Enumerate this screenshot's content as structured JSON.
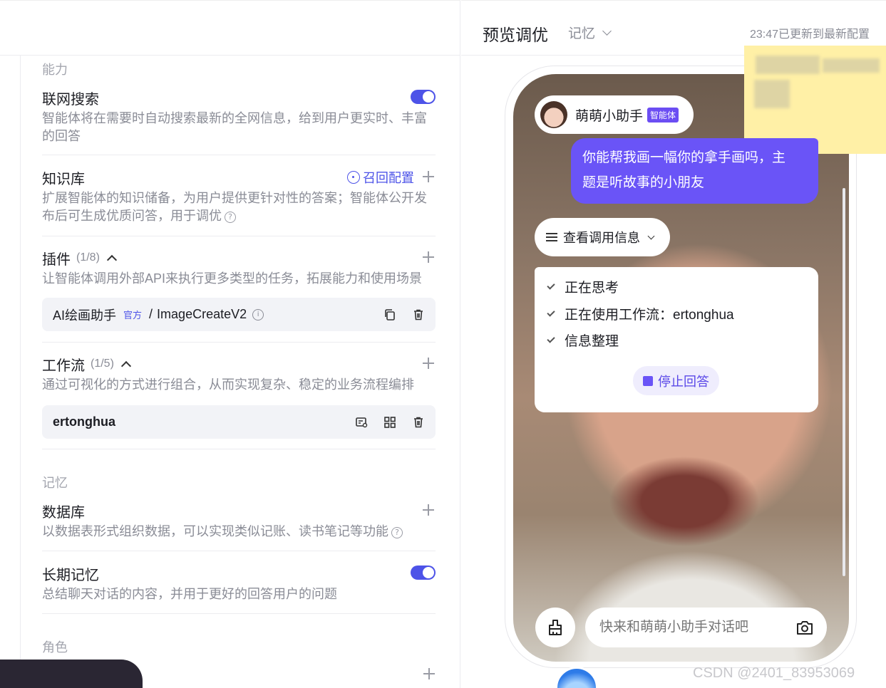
{
  "left": {
    "section_ability": "能力",
    "web_search": {
      "title": "联网搜索",
      "desc": "智能体将在需要时自动搜索最新的全网信息，给到用户更实时、丰富的回答",
      "enabled": true
    },
    "knowledge": {
      "title": "知识库",
      "recall_label": "召回配置",
      "desc": "扩展智能体的知识储备，为用户提供更针对性的答案；智能体公开发布后可生成优质问答，用于调优"
    },
    "plugins": {
      "title": "插件",
      "count": "(1/8)",
      "desc": "让智能体调用外部API来执行更多类型的任务，拓展能力和使用场景",
      "item": {
        "name": "AI绘画助手",
        "badge": "官方",
        "sep": "/",
        "api": "ImageCreateV2"
      }
    },
    "workflow": {
      "title": "工作流",
      "count": "(1/5)",
      "desc": "通过可视化的方式进行组合，从而实现复杂、稳定的业务流程编排",
      "item": {
        "name": "ertonghua"
      }
    },
    "section_memory": "记忆",
    "database": {
      "title": "数据库",
      "desc": "以数据表形式组织数据，可以实现类似记账、读书笔记等功能"
    },
    "long_memory": {
      "title": "长期记忆",
      "desc": "总结聊天对话的内容，并用于更好的回答用户的问题",
      "enabled": true
    },
    "section_role": "角色"
  },
  "right": {
    "title": "预览调优",
    "memory_dropdown": "记忆",
    "updated": "23:47已更新到最新配置",
    "bot": {
      "name": "萌萌小助手",
      "badge": "智能体"
    },
    "user_message_line1": "你能帮我画一幅你的拿手画吗，主",
    "user_message_line2": "题是听故事的小朋友",
    "call_info": "查看调用信息",
    "steps": [
      "正在思考",
      "正在使用工作流：ertonghua",
      "信息整理"
    ],
    "stop_label": "停止回答",
    "input_placeholder": "快来和萌萌小助手对话吧"
  },
  "watermark": "CSDN @2401_83953069"
}
